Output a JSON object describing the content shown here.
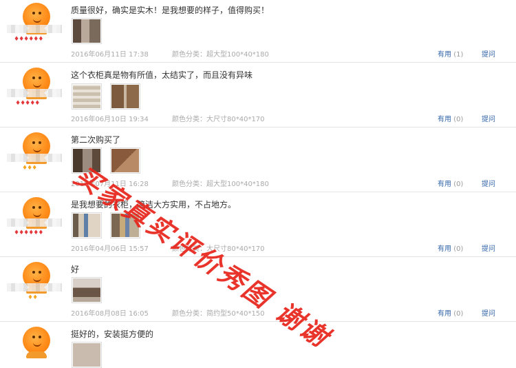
{
  "reviews": [
    {
      "content": "质量很好，确实是实木！是我想要的样子，值得购买！",
      "date": "2016年06月11日 17:38",
      "spec": "颜色分类：超大型100*40*180",
      "useful_label": "有用",
      "useful_count": "(1)",
      "ask_label": "提问",
      "level": "♦♦♦♦♦♦",
      "level_color": "#e4393c",
      "thumbnail_count": 1
    },
    {
      "content": "这个衣柜真是物有所值，太结实了，而且没有异味",
      "date": "2016年06月10日 19:34",
      "spec": "颜色分类：大尺寸80*40*170",
      "useful_label": "有用",
      "useful_count": "(0)",
      "ask_label": "提问",
      "level": "♦♦♦♦♦",
      "level_color": "#e4393c",
      "thumbnail_count": 2
    },
    {
      "content": "第二次购买了",
      "date": "2016年07月11日 16:28",
      "spec": "颜色分类：超大型100*40*180",
      "useful_label": "有用",
      "useful_count": "(0)",
      "ask_label": "提问",
      "level": "♦♦♦",
      "level_color": "#f5a623",
      "thumbnail_count": 2
    },
    {
      "content": "是我想要的衣柜，简洁大方实用，不占地方。",
      "date": "2016年04月06日 15:57",
      "spec": "颜色分类：大尺寸80*40*170",
      "useful_label": "有用",
      "useful_count": "(0)",
      "ask_label": "提问",
      "level": "♦♦♦♦♦♦",
      "level_color": "#e4393c",
      "thumbnail_count": 2
    },
    {
      "content": "好",
      "date": "2016年08月08日 16:05",
      "spec": "颜色分类：简约型50*40*150",
      "useful_label": "有用",
      "useful_count": "(0)",
      "ask_label": "提问",
      "level": "♦♦",
      "level_color": "#f5a623",
      "thumbnail_count": 1
    },
    {
      "content": "挺好的，安装挺方便的"
    }
  ],
  "watermark": "买家真实评价秀图 谢谢",
  "colors": {
    "link": "#3366aa",
    "meta": "#aaaaaa",
    "watermark": "#e8231a"
  }
}
